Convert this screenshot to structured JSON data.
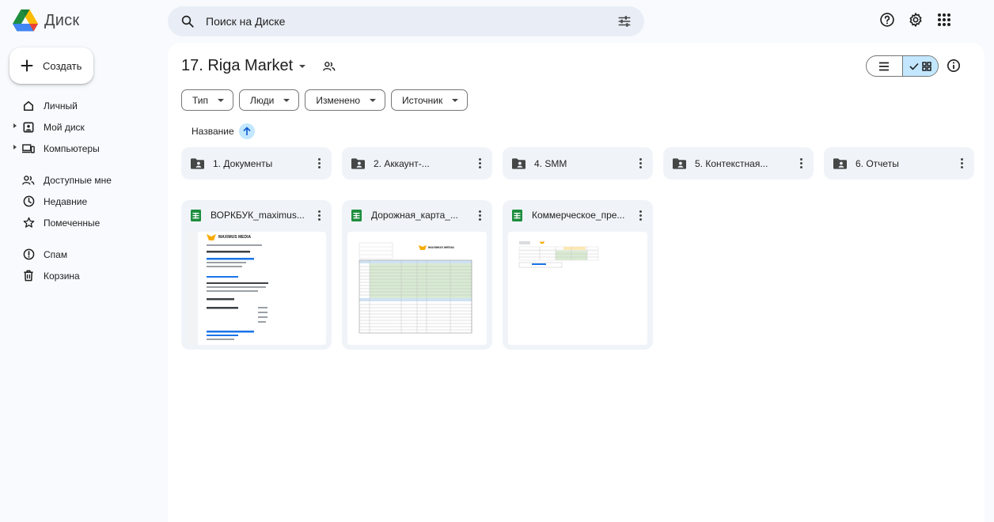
{
  "app": {
    "name": "Диск"
  },
  "search": {
    "placeholder": "Поиск на Диске"
  },
  "create_label": "Создать",
  "sidebar": {
    "items": [
      {
        "label": "Личный"
      },
      {
        "label": "Мой диск"
      },
      {
        "label": "Компьютеры"
      },
      {
        "label": "Доступные мне"
      },
      {
        "label": "Недавние"
      },
      {
        "label": "Помеченные"
      },
      {
        "label": "Спам"
      },
      {
        "label": "Корзина"
      }
    ]
  },
  "folder": {
    "title": "17. Riga Market"
  },
  "filters": [
    "Тип",
    "Люди",
    "Изменено",
    "Источник"
  ],
  "sort": {
    "label": "Название"
  },
  "folders": [
    {
      "name": "1. Документы"
    },
    {
      "name": "2. Аккаунт-..."
    },
    {
      "name": "4. SMM"
    },
    {
      "name": "5. Контекстная..."
    },
    {
      "name": "6. Отчеты"
    }
  ],
  "files": [
    {
      "name": "ВОРКБУК_maximus...",
      "thumb_logo": "MAXIMUS MEDIA"
    },
    {
      "name": "Дорожная_карта_...",
      "thumb_logo": "MAXIMUS MEDIA"
    },
    {
      "name": "Коммерческое_пре..."
    }
  ],
  "colors": {
    "accent": "#c2e7ff",
    "card": "#f0f4f9",
    "sheets_green": "#1e8e3e"
  }
}
